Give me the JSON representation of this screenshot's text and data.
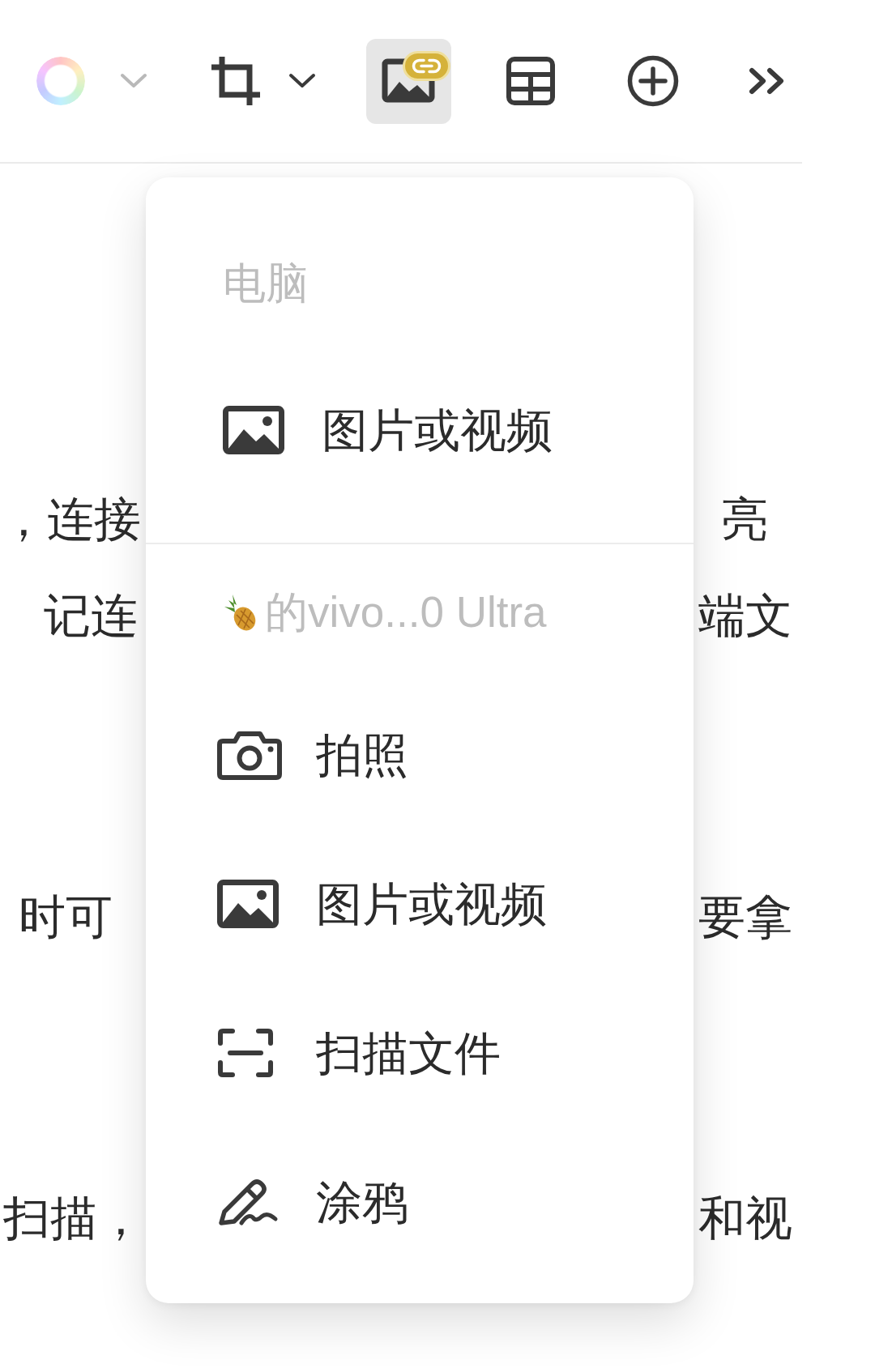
{
  "toolbar": {
    "tools": [
      {
        "kind": "color",
        "selected": false,
        "disabled": true,
        "dropdown": true
      },
      {
        "kind": "crop",
        "selected": false,
        "disabled": false,
        "dropdown": true
      },
      {
        "kind": "image",
        "selected": true,
        "disabled": false,
        "dropdown": false
      },
      {
        "kind": "table",
        "selected": false,
        "disabled": false,
        "dropdown": false
      },
      {
        "kind": "add",
        "selected": false,
        "disabled": false,
        "dropdown": false
      },
      {
        "kind": "more",
        "selected": false,
        "disabled": false,
        "dropdown": false
      }
    ]
  },
  "document": {
    "paragraphs": [
      {
        "lines": [
          {
            "left": "，连接",
            "right": "亮"
          },
          {
            "left": "记连",
            "right": "端文"
          }
        ]
      },
      {
        "lines": [
          {
            "left": "时可",
            "right": "要拿"
          }
        ]
      },
      {
        "lines": [
          {
            "left": "扫描，",
            "right": "和视"
          }
        ]
      }
    ]
  },
  "insert_menu": {
    "sections": [
      {
        "kind": "computer",
        "title": "电脑",
        "items": [
          {
            "kind": "media",
            "label": "图片或视频"
          }
        ]
      },
      {
        "kind": "device",
        "title": "的vivo...0 Ultra",
        "items": [
          {
            "kind": "camera",
            "label": "拍照"
          },
          {
            "kind": "media",
            "label": "图片或视频"
          },
          {
            "kind": "scan",
            "label": "扫描文件"
          },
          {
            "kind": "sketch",
            "label": "涂鸦"
          }
        ]
      }
    ]
  }
}
